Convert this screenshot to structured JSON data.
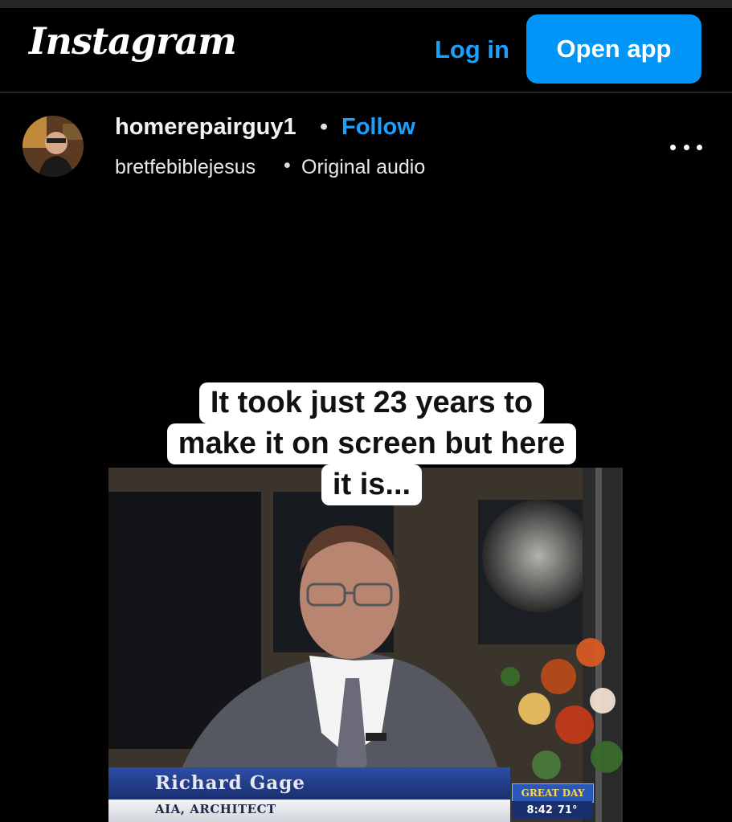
{
  "header": {
    "logo": "Instagram",
    "login_label": "Log in",
    "open_app_label": "Open app"
  },
  "post": {
    "username": "homerepairguy1",
    "separator": "•",
    "follow_label": "Follow",
    "audio_user": "bretfebiblejesus",
    "audio_name": "Original audio"
  },
  "video": {
    "caption_lines": [
      "It took just 23 years to",
      "make it on screen but here",
      "it is..."
    ],
    "lower_third": {
      "name": "Richard Gage",
      "title": "AIA, ARCHITECT"
    },
    "station": {
      "logo_text": "GREAT DAY",
      "time": "8:42",
      "temperature": "71°"
    }
  },
  "colors": {
    "accent": "#0095f6",
    "link": "#1aa0ff",
    "background": "#000000"
  }
}
